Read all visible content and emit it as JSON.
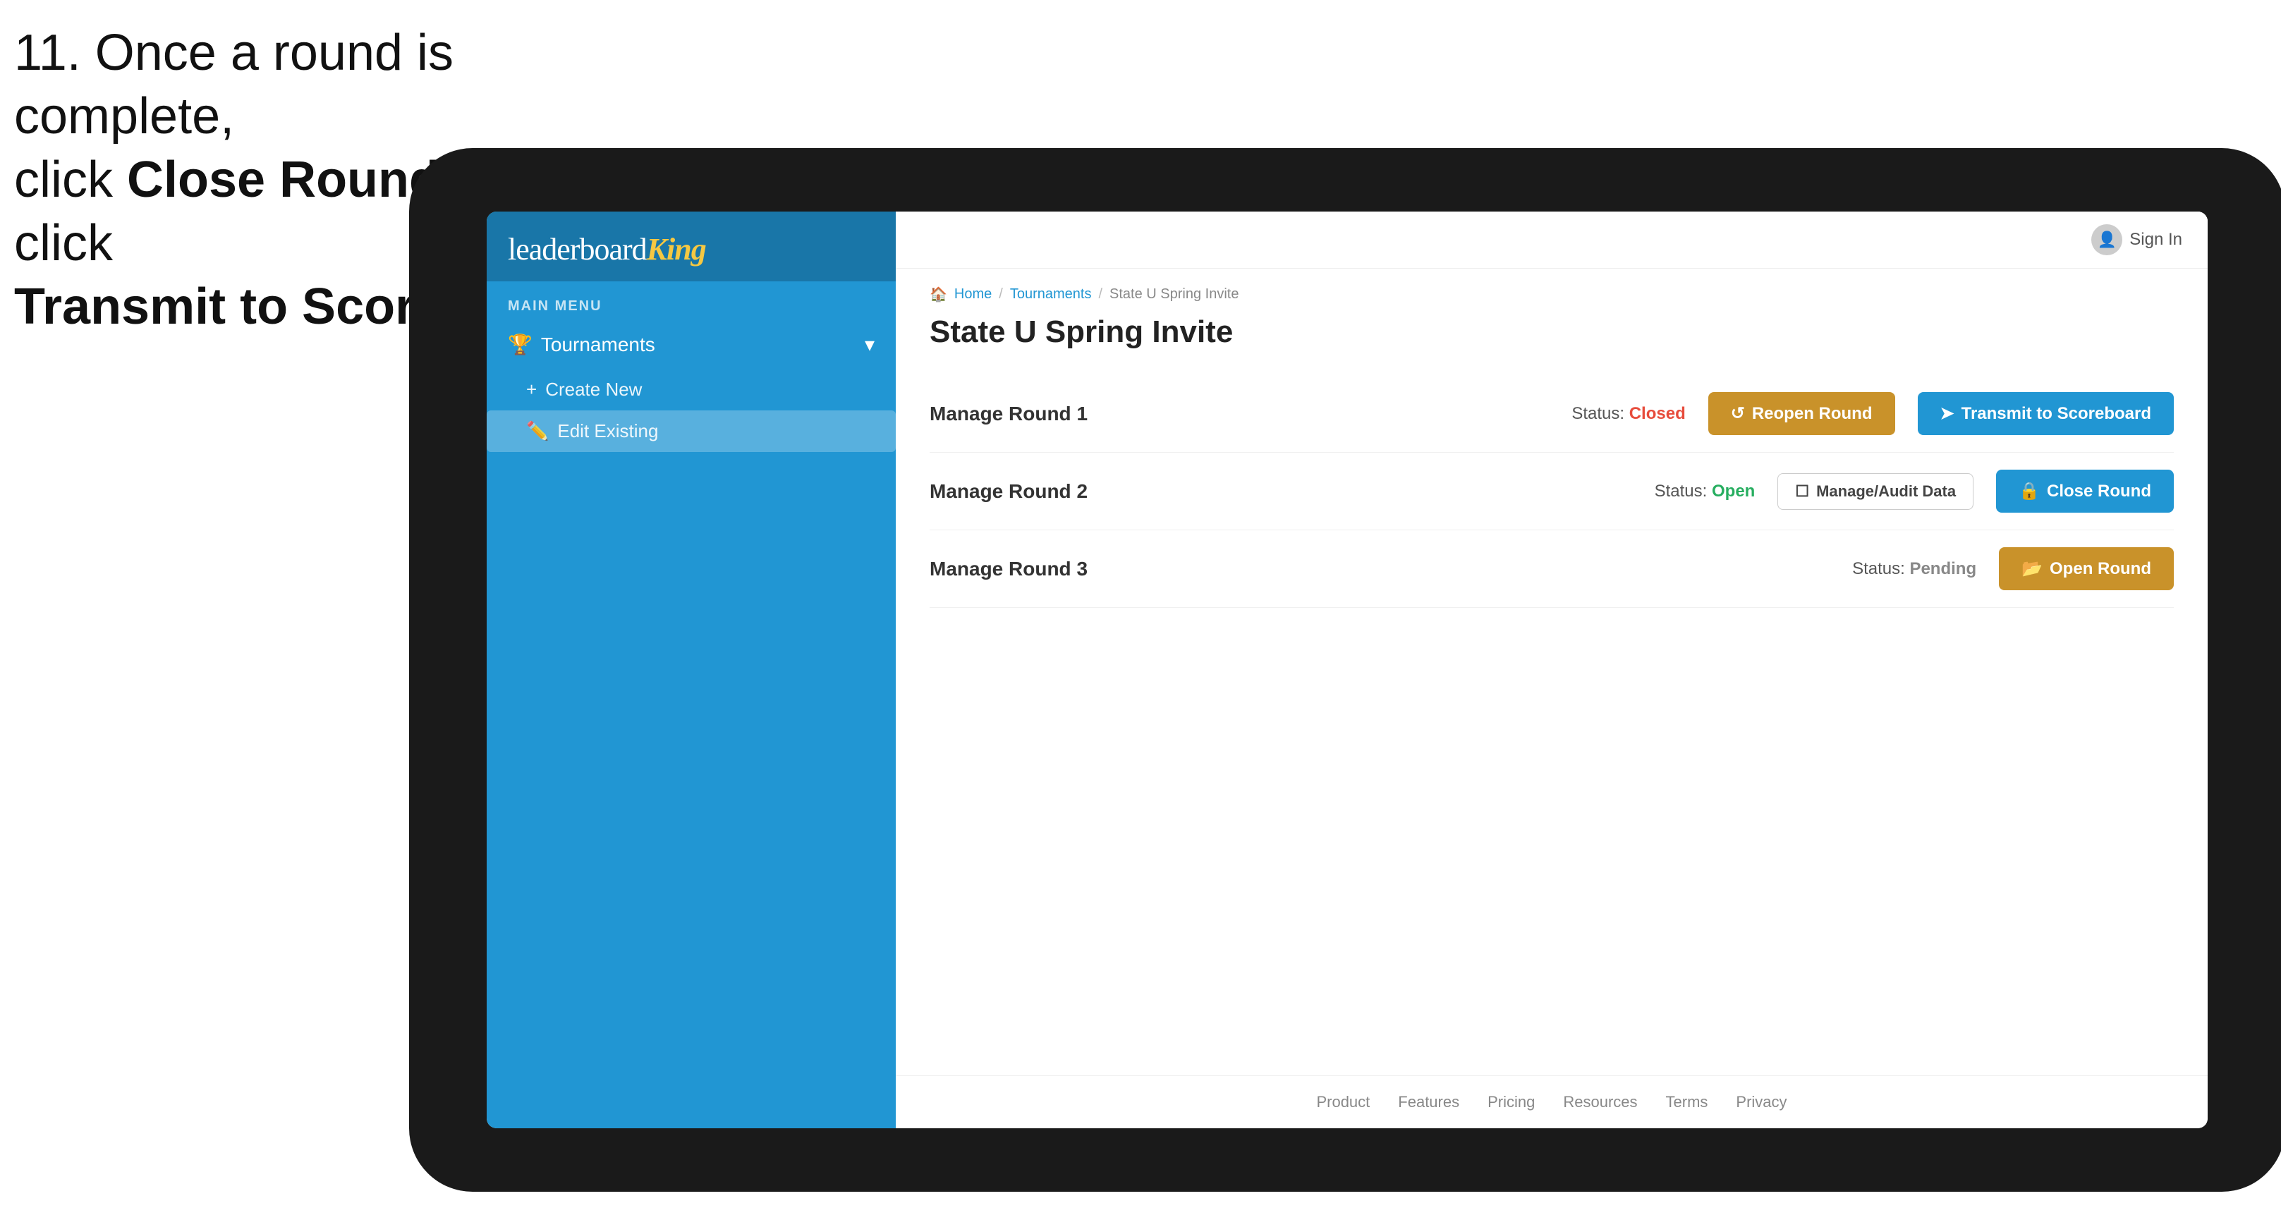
{
  "instruction": {
    "line1": "11. Once a round is complete,",
    "line2": "click ",
    "bold1": "Close Round",
    "line3": " then click",
    "bold2": "Transmit to Scoreboard."
  },
  "sidebar": {
    "logo": {
      "brand": "leaderboard",
      "king": "King"
    },
    "main_menu_label": "MAIN MENU",
    "items": [
      {
        "label": "Tournaments",
        "icon": "trophy"
      }
    ],
    "sub_items": [
      {
        "label": "Create New",
        "icon": "plus"
      },
      {
        "label": "Edit Existing",
        "icon": "edit",
        "active": true
      }
    ]
  },
  "header": {
    "sign_in_label": "Sign In"
  },
  "breadcrumb": {
    "home": "Home",
    "tournaments": "Tournaments",
    "current": "State U Spring Invite"
  },
  "page": {
    "title": "State U Spring Invite",
    "rounds": [
      {
        "label": "Manage Round 1",
        "status_label": "Status:",
        "status_value": "Closed",
        "status_class": "status-closed",
        "buttons": [
          {
            "label": "Reopen Round",
            "style": "gold",
            "icon": "refresh"
          },
          {
            "label": "Transmit to Scoreboard",
            "style": "blue",
            "icon": "send"
          }
        ]
      },
      {
        "label": "Manage Round 2",
        "status_label": "Status:",
        "status_value": "Open",
        "status_class": "status-open",
        "buttons": [
          {
            "label": "Manage/Audit Data",
            "style": "manage",
            "icon": "file"
          },
          {
            "label": "Close Round",
            "style": "blue",
            "icon": "lock"
          }
        ]
      },
      {
        "label": "Manage Round 3",
        "status_label": "Status:",
        "status_value": "Pending",
        "status_class": "status-pending",
        "buttons": [
          {
            "label": "Open Round",
            "style": "gold",
            "icon": "folder-open"
          }
        ]
      }
    ]
  },
  "footer": {
    "links": [
      "Product",
      "Features",
      "Pricing",
      "Resources",
      "Terms",
      "Privacy"
    ]
  }
}
